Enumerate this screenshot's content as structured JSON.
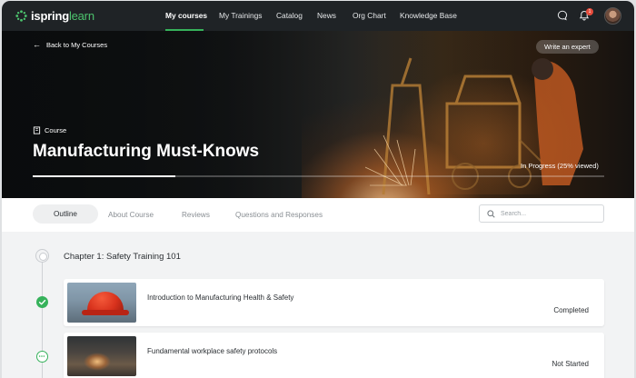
{
  "app": {
    "logo_prefix": "ispring",
    "logo_suffix": "learn",
    "brand_color": "#36b25b"
  },
  "nav": {
    "items": [
      {
        "label": "My courses",
        "active": true
      },
      {
        "label": "My Trainings"
      },
      {
        "label": "Catalog"
      },
      {
        "label": "News"
      },
      {
        "label": "Org Chart"
      },
      {
        "label": "Knowledge Base"
      }
    ],
    "notification_count": "1",
    "icons": [
      "chat-icon",
      "bell-icon",
      "avatar"
    ]
  },
  "hero": {
    "back_label": "Back to My Courses",
    "write_expert_label": "Write an expert",
    "type_label": "Course",
    "title": "Manufacturing Must-Knows",
    "progress_label": "In Progress (25% viewed)",
    "progress_percent": 25
  },
  "tabs": [
    {
      "label": "Outline",
      "active": true
    },
    {
      "label": "About Course"
    },
    {
      "label": "Reviews"
    },
    {
      "label": "Questions and Responses"
    }
  ],
  "search": {
    "placeholder": "Search..."
  },
  "outline": {
    "chapter_title": "Chapter 1: Safety Training 101",
    "items": [
      {
        "title": "Introduction to Manufacturing Health & Safety",
        "status": "Completed"
      },
      {
        "title": "Fundamental workplace safety protocols",
        "status": "Not Started"
      }
    ]
  }
}
